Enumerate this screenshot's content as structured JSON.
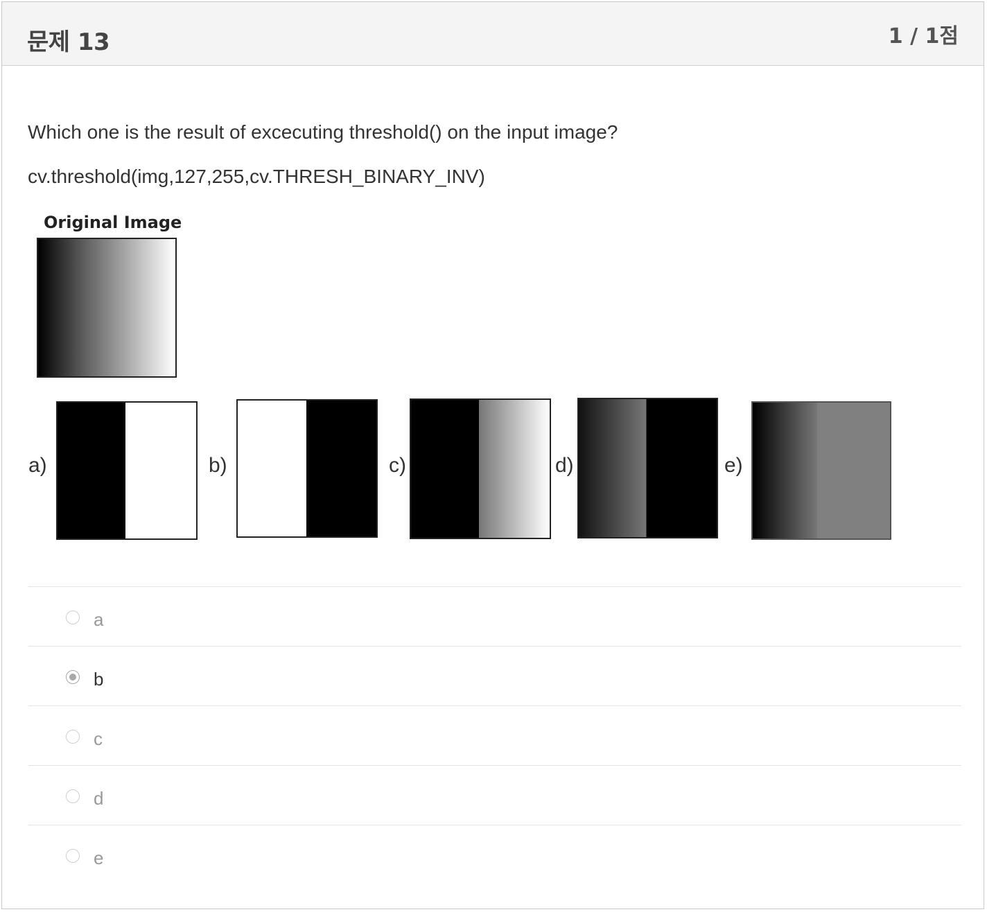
{
  "header": {
    "title": "문제 13",
    "score": "1 / 1점"
  },
  "question": {
    "text": "Which one is the result of excecuting threshold() on the input image?",
    "code": "cv.threshold(img,127,255,cv.THRESH_BINARY_INV)"
  },
  "figure": {
    "original_label": "Original Image",
    "option_labels": [
      "a)",
      "b)",
      "c)",
      "d)",
      "e)"
    ]
  },
  "choices": [
    {
      "label": "a",
      "selected": false
    },
    {
      "label": "b",
      "selected": true
    },
    {
      "label": "c",
      "selected": false
    },
    {
      "label": "d",
      "selected": false
    },
    {
      "label": "e",
      "selected": false
    }
  ]
}
